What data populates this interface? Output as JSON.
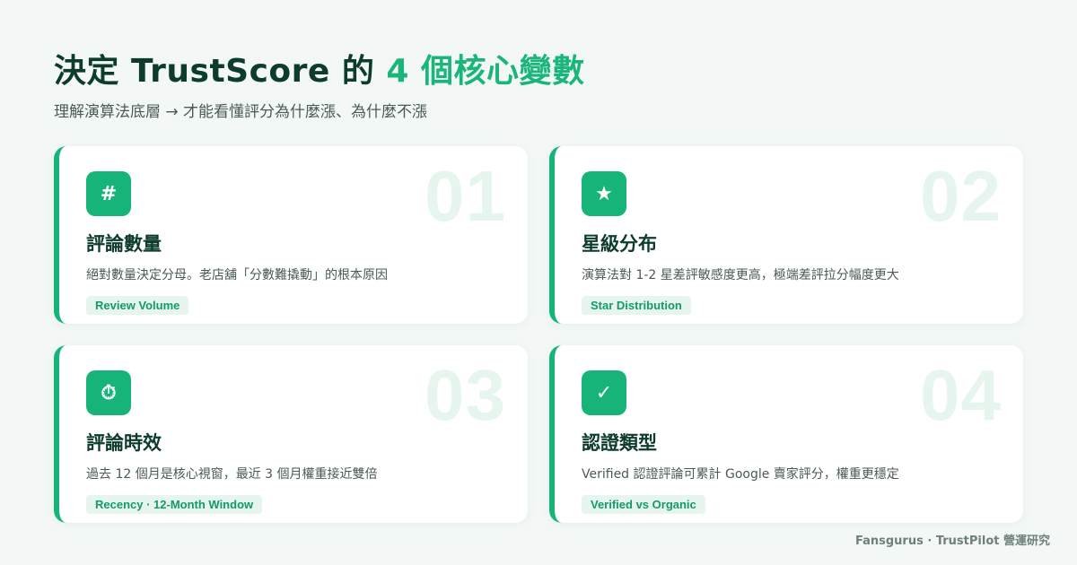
{
  "header": {
    "title_main": "決定 TrustScore 的 ",
    "title_accent": "4 個核心變數",
    "subtitle": "理解演算法底層 → 才能看懂評分為什麼漲、為什麼不漲"
  },
  "colors": {
    "accent": "#17b47a",
    "title": "#0d3b2e",
    "background": "#f3f8f6"
  },
  "cards": [
    {
      "number": "01",
      "icon": "hash-icon",
      "icon_glyph": "#",
      "title": "評論數量",
      "description": "絕對數量決定分母。老店舖「分數難撬動」的根本原因",
      "tag": "Review Volume"
    },
    {
      "number": "02",
      "icon": "star-icon",
      "icon_glyph": "★",
      "title": "星級分布",
      "description": "演算法對 1-2 星差評敏感度更高，極端差評拉分幅度更大",
      "tag": "Star Distribution"
    },
    {
      "number": "03",
      "icon": "stopwatch-icon",
      "icon_glyph": "⏱",
      "title": "評論時效",
      "description": "過去 12 個月是核心視窗，最近 3 個月權重接近雙倍",
      "tag": "Recency · 12-Month Window"
    },
    {
      "number": "04",
      "icon": "checkmark-icon",
      "icon_glyph": "✓",
      "title": "認證類型",
      "description": "Verified 認證評論可累計 Google 賣家評分，權重更穩定",
      "tag": "Verified vs Organic"
    }
  ],
  "footer": {
    "credit": "Fansgurus · TrustPilot 營運研究"
  }
}
